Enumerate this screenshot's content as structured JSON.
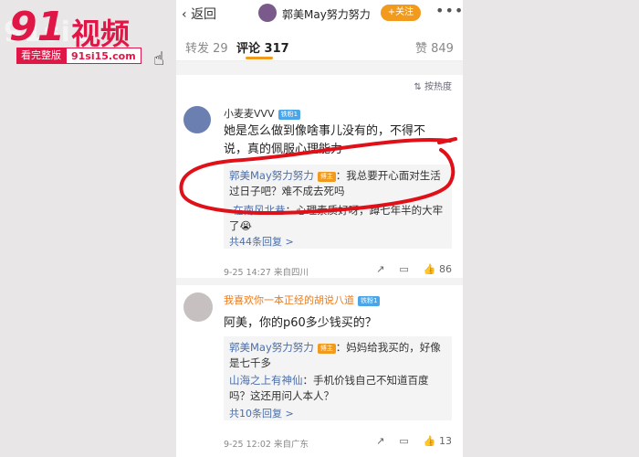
{
  "watermark": {
    "ghost": "91si1",
    "logo_num": "91",
    "logo_title": "视频",
    "watch_label": "看完整版",
    "site": "91si15.com"
  },
  "topbar": {
    "back_label": "返回",
    "title": "郭美May努力努力",
    "follow_label": "+关注",
    "more_icon": "more-icon"
  },
  "tabs": {
    "repost": "转发 29",
    "comments": "评论 317",
    "likes": "赞 849"
  },
  "sort": {
    "label": "按热度"
  },
  "comments": [
    {
      "username": "小麦麦VVV",
      "badge": "铁粉1",
      "text": "她是怎么做到像啥事儿没有的，不得不说，真的佩服心理能力",
      "replies": [
        {
          "author": "郭美May努力努力",
          "badge": "博主",
          "text": "：我总要开心面对生活过日子吧？难不成去死吗"
        },
        {
          "author": "-在南风北巷",
          "badge": "",
          "text": "：心理素质好呀，蹲七年半的大牢了😭"
        }
      ],
      "more_replies": "共44条回复 >",
      "time": "9-25 14:27",
      "source": "来自四川",
      "likes": "86"
    },
    {
      "username": "我喜欢你一本正经的胡说八道",
      "badge": "铁粉1",
      "text": "阿美，你的p60多少钱买的？",
      "replies": [
        {
          "author": "郭美May努力努力",
          "badge": "博主",
          "text": "：妈妈给我买的，好像是七千多"
        },
        {
          "author": "山海之上有神仙",
          "badge": "",
          "text": "：手机价钱自己不知道百度吗？这还用问人本人？"
        }
      ],
      "more_replies": "共10条回复 >",
      "time": "9-25 12:02",
      "source": "来自广东",
      "likes": "13"
    }
  ],
  "colors": {
    "accent": "#f29a1b",
    "link": "#4c6ea8",
    "annotation": "#e01018",
    "watermark": "#e01646"
  }
}
